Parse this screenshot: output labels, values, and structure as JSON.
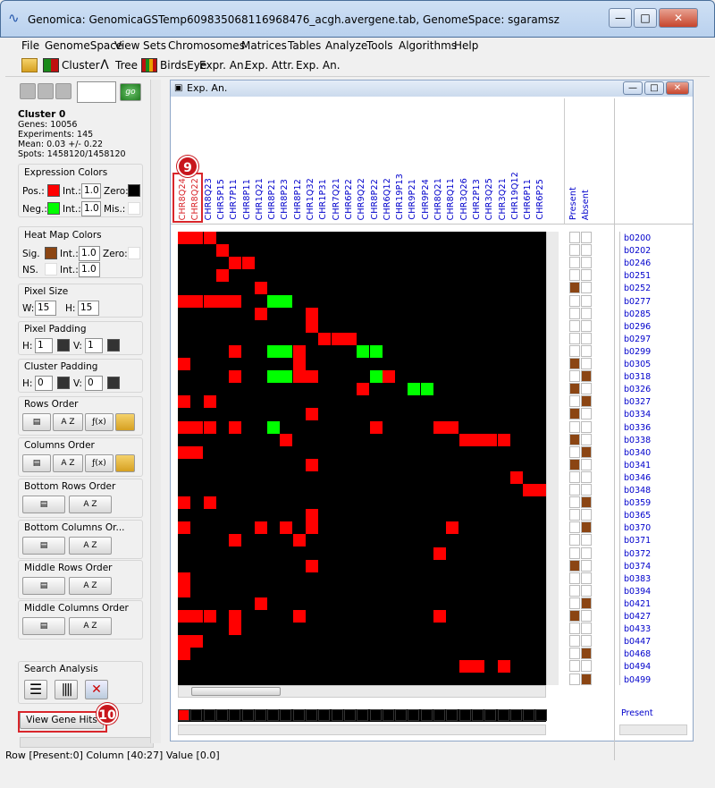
{
  "window": {
    "title": "Genomica: GenomicaGSTemp609835068116968476_acgh.avergene.tab, GenomeSpace: sgaramsz",
    "min": "—",
    "max": "□",
    "close": "✕"
  },
  "menu": [
    "File",
    "GenomeSpace",
    "View",
    "Sets",
    "Chromosomes",
    "Matrices",
    "Tables",
    "Analyze",
    "Tools",
    "Algorithms",
    "Help"
  ],
  "toolbar": {
    "cluster": "Cluster",
    "tree": "Tree",
    "birdseye": "BirdsEye",
    "exp_an": "Expr. An.",
    "exp_attr": "Exp. Attr.",
    "exp_an2": "Exp. An."
  },
  "cluster_info": {
    "title": "Cluster 0",
    "genes": "Genes: 10056",
    "experiments": "Experiments: 145",
    "mean": "Mean: 0.03 +/- 0.22",
    "spots": "Spots: 1458120/1458120"
  },
  "expression_colors": {
    "title": "Expression Colors",
    "pos": "Pos.:",
    "neg": "Neg.:",
    "int": "Int.:",
    "int_pos": "1.0",
    "int_neg": "1.0",
    "zero": "Zero:",
    "mis": "Mis.:",
    "pos_color": "#ff0000",
    "neg_color": "#00ff00",
    "zero_color": "#000000",
    "mis_color": "#ffffff"
  },
  "heatmap_colors": {
    "title": "Heat Map Colors",
    "sig": "Sig.",
    "ns": "NS.",
    "int": "Int.:",
    "int_sig": "1.0",
    "int_ns": "1.0",
    "zero": "Zero:",
    "sig_color": "#8b4513",
    "ns_color": "#ffffff",
    "zero_color": "#ffffff"
  },
  "pixel_size": {
    "title": "Pixel Size",
    "w_label": "W:",
    "w": "15",
    "h_label": "H:",
    "h": "15"
  },
  "pixel_padding": {
    "title": "Pixel Padding",
    "h_label": "H:",
    "h": "1",
    "v_label": "V:",
    "v": "1"
  },
  "cluster_padding": {
    "title": "Cluster Padding",
    "h_label": "H:",
    "h": "0",
    "v_label": "V:",
    "v": "0"
  },
  "orders": [
    "Rows Order",
    "Columns Order",
    "Bottom Rows Order",
    "Bottom Columns Or...",
    "Middle Rows Order",
    "Middle Columns Order"
  ],
  "fx": "ƒ(x)",
  "az": "A Z",
  "search": {
    "title": "Search Analysis",
    "view_gene_hits": "View Gene Hits"
  },
  "inner_frame": {
    "title": "Exp. An."
  },
  "columns": [
    "CHR8Q24",
    "CHR8Q22",
    "CHR8Q23",
    "CHR5P15",
    "CHR7P11",
    "CHR8P11",
    "CHR1Q21",
    "CHR8P21",
    "CHR8P23",
    "CHR8P12",
    "CHR1Q32",
    "CHR1P31",
    "CHR7Q21",
    "CHR6P22",
    "CHR9Q22",
    "CHR8P22",
    "CHR6Q12",
    "CHR19P13",
    "CHR9P21",
    "CHR9P24",
    "CHR8Q21",
    "CHR8Q11",
    "CHR3Q26",
    "CHR2P13",
    "CHR3Q25",
    "CHR3Q21",
    "CHR19Q12",
    "CHR6P11",
    "CHR6P25"
  ],
  "attr_columns": [
    "Present",
    "Absent"
  ],
  "rows": [
    "b0200",
    "b0202",
    "b0246",
    "b0251",
    "b0252",
    "b0277",
    "b0285",
    "b0296",
    "b0297",
    "b0299",
    "b0305",
    "b0318",
    "b0326",
    "b0327",
    "b0334",
    "b0336",
    "b0338",
    "b0340",
    "b0341",
    "b0346",
    "b0348",
    "b0359",
    "b0365",
    "b0370",
    "b0371",
    "b0372",
    "b0374",
    "b0383",
    "b0394",
    "b0421",
    "b0427",
    "b0433",
    "b0447",
    "b0468",
    "b0494",
    "b0499"
  ],
  "bottom_label": "Present",
  "status": "Row [Present:0] Column [40:27] Value [0.0]",
  "callouts": {
    "c9": "9",
    "c10": "10"
  }
}
